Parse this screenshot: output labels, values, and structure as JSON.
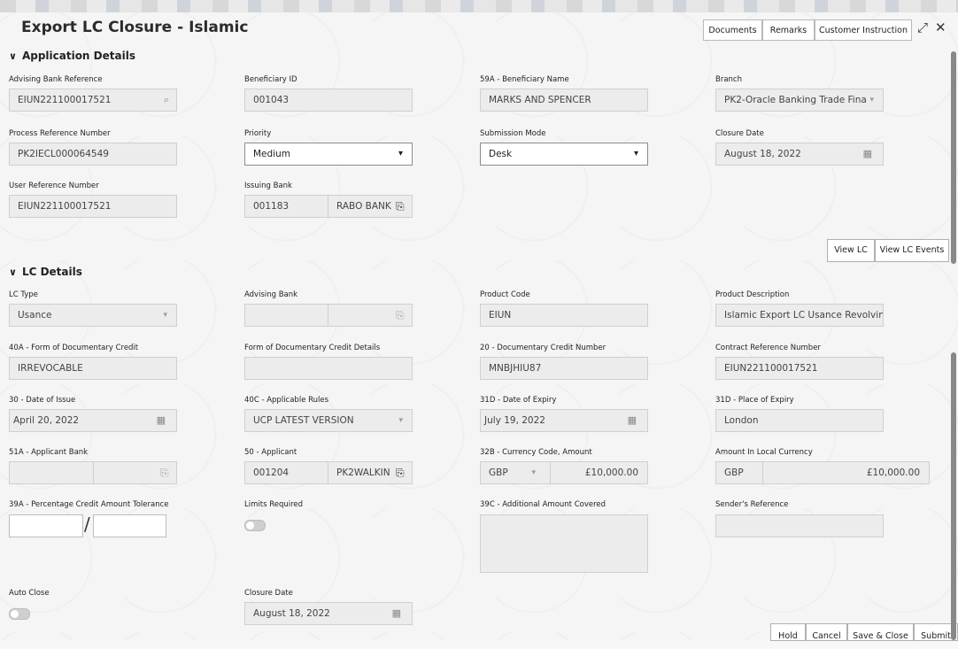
{
  "header": {
    "title": "Export LC Closure - Islamic",
    "buttons": {
      "documents": "Documents",
      "remarks": "Remarks",
      "customer_instruction": "Customer Instruction"
    },
    "expand_glyph": "⤢",
    "close_glyph": "✕"
  },
  "application_details": {
    "heading": "Application Details",
    "advising_bank_reference": {
      "label": "Advising Bank Reference",
      "value": "EIUN221100017521"
    },
    "beneficiary_id": {
      "label": "Beneficiary ID",
      "value": "001043"
    },
    "beneficiary_name": {
      "label": "59A - Beneficiary Name",
      "value": "MARKS AND SPENCER"
    },
    "branch": {
      "label": "Branch",
      "value": "PK2-Oracle Banking Trade Fina"
    },
    "process_reference_number": {
      "label": "Process Reference Number",
      "value": "PK2IECL000064549"
    },
    "priority": {
      "label": "Priority",
      "value": "Medium"
    },
    "submission_mode": {
      "label": "Submission Mode",
      "value": "Desk"
    },
    "closure_date": {
      "label": "Closure Date",
      "value": "August 18, 2022"
    },
    "user_reference_number": {
      "label": "User Reference Number",
      "value": "EIUN221100017521"
    },
    "issuing_bank": {
      "label": "Issuing Bank",
      "code": "001183",
      "name": "RABO BANK"
    },
    "view_lc": "View LC",
    "view_lc_events": "View LC Events"
  },
  "lc_details": {
    "heading": "LC Details",
    "lc_type": {
      "label": "LC Type",
      "value": "Usance"
    },
    "advising_bank": {
      "label": "Advising Bank",
      "code": "",
      "name": ""
    },
    "product_code": {
      "label": "Product Code",
      "value": "EIUN"
    },
    "product_description": {
      "label": "Product Description",
      "value": "Islamic Export LC Usance Revolving"
    },
    "form_of_documentary_credit": {
      "label": "40A - Form of Documentary Credit",
      "value": "IRREVOCABLE"
    },
    "form_of_documentary_credit_details": {
      "label": "Form of Documentary Credit Details",
      "value": ""
    },
    "documentary_credit_number": {
      "label": "20 - Documentary Credit Number",
      "value": "MNBJHIU87"
    },
    "contract_reference_number": {
      "label": "Contract Reference Number",
      "value": "EIUN221100017521"
    },
    "date_of_issue": {
      "label": "30 - Date of Issue",
      "value": "April 20, 2022"
    },
    "applicable_rules": {
      "label": "40C - Applicable Rules",
      "value": "UCP LATEST VERSION"
    },
    "date_of_expiry": {
      "label": "31D - Date of Expiry",
      "value": "July 19, 2022"
    },
    "place_of_expiry": {
      "label": "31D - Place of Expiry",
      "value": "London"
    },
    "applicant_bank": {
      "label": "51A - Applicant Bank",
      "code": "",
      "name": ""
    },
    "applicant": {
      "label": "50 - Applicant",
      "code": "001204",
      "name": "PK2WALKIN"
    },
    "currency_amount": {
      "label": "32B - Currency Code, Amount",
      "currency": "GBP",
      "amount": "£10,000.00"
    },
    "amount_local_currency": {
      "label": "Amount In Local Currency",
      "currency": "GBP",
      "amount": "£10,000.00"
    },
    "percentage_tolerance": {
      "label": "39A - Percentage Credit Amount Tolerance",
      "plus": "",
      "minus": "",
      "separator": "/"
    },
    "limits_required": {
      "label": "Limits Required",
      "enabled": false
    },
    "additional_amount_covered": {
      "label": "39C - Additional Amount Covered",
      "value": ""
    },
    "senders_reference": {
      "label": "Sender's Reference",
      "value": ""
    },
    "auto_close": {
      "label": "Auto Close",
      "enabled": false
    },
    "closure_date": {
      "label": "Closure Date",
      "value": "August 18, 2022"
    }
  },
  "footer": {
    "hold": "Hold",
    "cancel": "Cancel",
    "save_close": "Save & Close",
    "submit": "Submit"
  },
  "icons": {
    "search": "⌕",
    "calendar": "▦",
    "caret": "▾",
    "document": "⎘",
    "chevron": "﹀"
  }
}
